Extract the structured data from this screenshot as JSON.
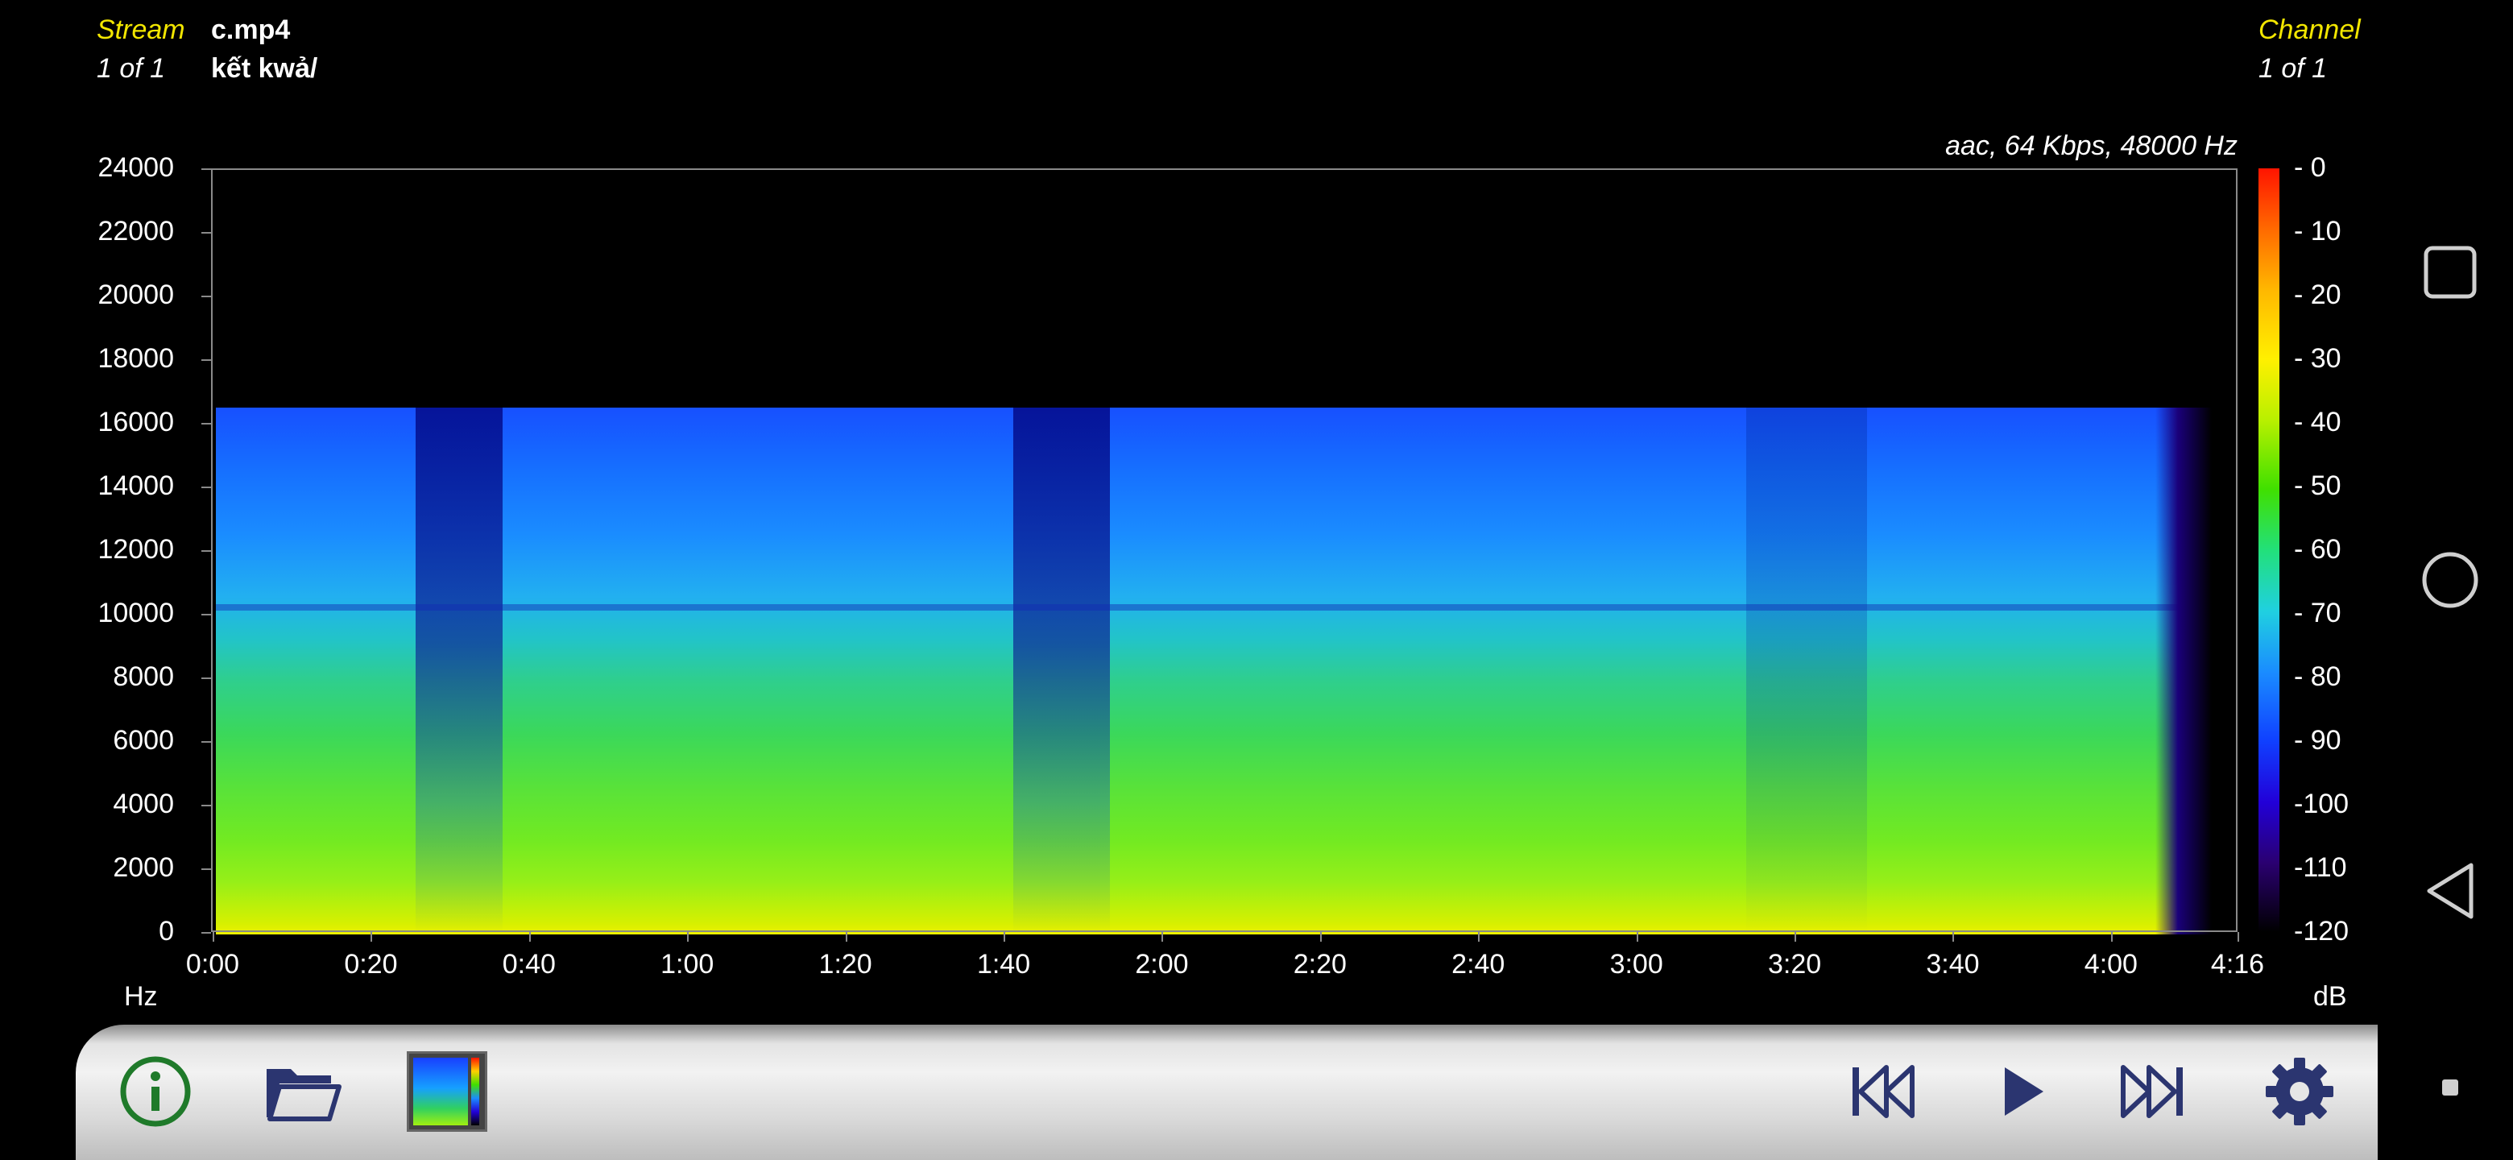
{
  "header": {
    "stream_label": "Stream",
    "stream_count": "1 of 1",
    "file_name": "c.mp4",
    "folder_name": "kết kwả/",
    "channel_label": "Channel",
    "channel_count": "1 of 1",
    "codec_info": "aac, 64 Kbps, 48000 Hz"
  },
  "y_axis": {
    "unit": "Hz",
    "ticks": [
      "24000",
      "22000",
      "20000",
      "18000",
      "16000",
      "14000",
      "12000",
      "10000",
      "8000",
      "6000",
      "4000",
      "2000",
      "0"
    ]
  },
  "x_axis": {
    "ticks": [
      "0:00",
      "0:20",
      "0:40",
      "1:00",
      "1:20",
      "1:40",
      "2:00",
      "2:20",
      "2:40",
      "3:00",
      "3:20",
      "3:40",
      "4:00",
      "4:16"
    ]
  },
  "colorbar": {
    "unit": "dB",
    "ticks": [
      "- 0",
      "- 10",
      "- 20",
      "- 30",
      "- 40",
      "- 50",
      "- 60",
      "- 70",
      "- 80",
      "- 90",
      "-100",
      "-110",
      "-120"
    ]
  },
  "toolbar": {
    "icons": [
      "info-icon",
      "folder-open-icon",
      "colormap-icon",
      "skip-previous-icon",
      "play-icon",
      "skip-next-icon",
      "gear-icon"
    ]
  },
  "nav": {
    "icons": [
      "recent-apps-icon",
      "home-icon",
      "back-icon",
      "menu-dot-icon"
    ]
  },
  "colors": {
    "accent_yellow": "#f2e600",
    "icon_navy": "#2b3570",
    "info_green": "#1f7a2a"
  }
}
